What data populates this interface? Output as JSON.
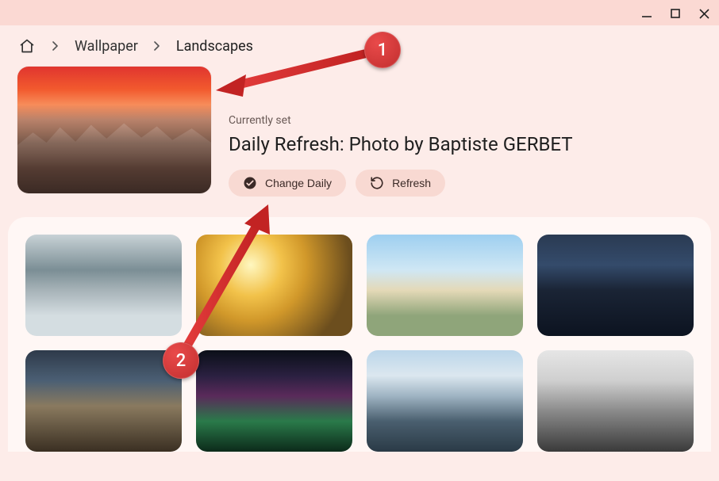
{
  "breadcrumb": {
    "items": [
      "Wallpaper",
      "Landscapes"
    ]
  },
  "hero": {
    "subtitle": "Currently set",
    "title": "Daily Refresh: Photo by Baptiste GERBET",
    "change_daily_label": "Change Daily",
    "refresh_label": "Refresh"
  },
  "annotations": {
    "badge1": "1",
    "badge2": "2"
  }
}
